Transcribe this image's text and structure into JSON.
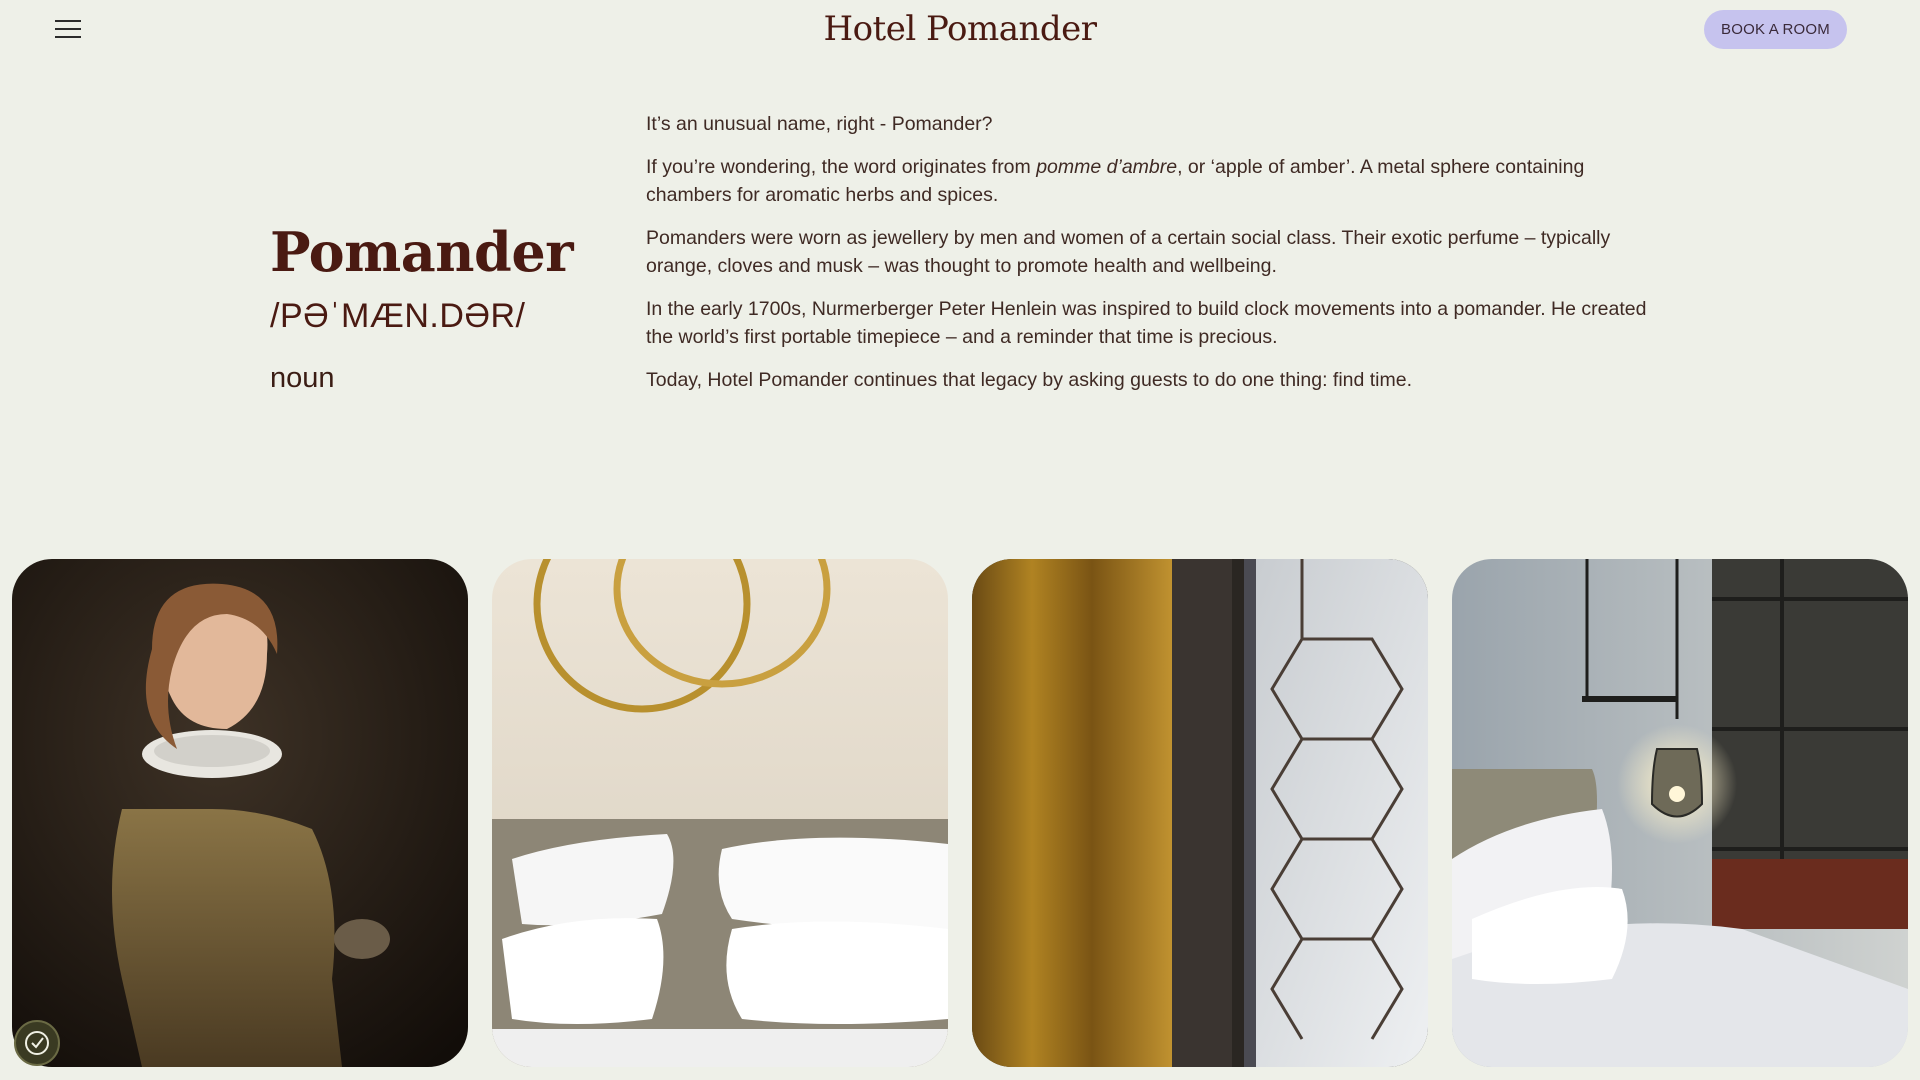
{
  "header": {
    "brand": "Hotel Pomander",
    "book_label": "BOOK A ROOM",
    "menu_icon": "hamburger-menu-icon"
  },
  "definition": {
    "word": "Pomander",
    "phonetic": "/PƏˈMÆN.DƏR/",
    "part_of_speech": "noun"
  },
  "intro": {
    "p1": "It’s an unusual name, right - Pomander?",
    "p2_before": "If you’re wondering, the word originates from ",
    "p2_italic": "pomme d’ambre",
    "p2_after": ", or ‘apple of amber’. A metal sphere containing chambers for aromatic herbs and spices.",
    "p3": "Pomanders were worn as jewellery by men and women of a certain social class. Their exotic perfume – typically orange, cloves and musk – was thought to promote health and wellbeing.",
    "p4": "In the early 1700s, Nurmerberger Peter Henlein was inspired to build clock movements into a pomander. He created the world’s first portable timepiece – and a reminder that time is precious.",
    "p5": "Today, Hotel Pomander continues that legacy by asking guests to do one thing: find time."
  },
  "gallery": {
    "images": [
      "portrait-woman-ruff-collar",
      "bed-pillows-brass-mirror",
      "gold-curtain-leaded-window",
      "bedroom-pendant-lamp"
    ]
  },
  "cookie": {
    "icon": "cookie-settings-icon"
  },
  "colors": {
    "background": "#eef0e8",
    "brand": "#4a1a12",
    "button": "#c6c3ee"
  }
}
